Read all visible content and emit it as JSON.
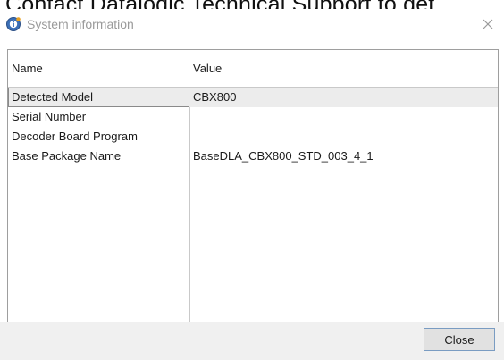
{
  "background_text": "Contact Datalogic Technical Support to det",
  "window": {
    "title": "System information",
    "close_glyph": "✕",
    "title_icon": "info-gear-icon"
  },
  "table": {
    "columns": [
      "Name",
      "Value"
    ],
    "rows": [
      {
        "name": "Detected Model",
        "value": "CBX800",
        "selected": true
      },
      {
        "name": "Serial Number",
        "value": ""
      },
      {
        "name": "Decoder Board Program",
        "value": ""
      },
      {
        "name": "Base Package Name",
        "value": "BaseDLA_CBX800_STD_003_4_1"
      }
    ]
  },
  "footer": {
    "close_label": "Close"
  },
  "colors": {
    "title_text": "#9a9a9a",
    "selected_row": "#ececec",
    "button_border": "#7a9cc2"
  }
}
